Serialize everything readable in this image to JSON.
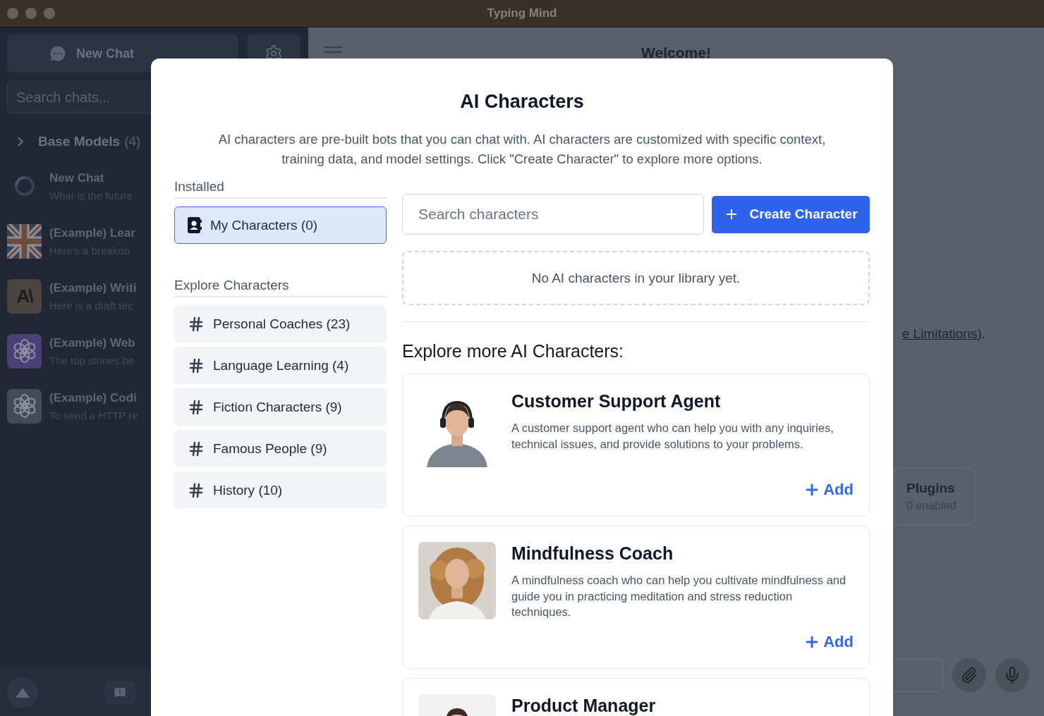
{
  "window": {
    "title": "Typing Mind"
  },
  "sidebar": {
    "new_chat": "New Chat",
    "search_placeholder": "Search chats...",
    "group": {
      "label": "Base Models",
      "count": "(4)",
      "expanded": false
    },
    "chats": [
      {
        "kind": "spinner",
        "title": "New Chat",
        "preview": "What is the future"
      },
      {
        "kind": "flag",
        "title": "(Example) Lear",
        "preview": "Here's a breakdo"
      },
      {
        "kind": "logo",
        "logo_text": "A\\",
        "color": "#4a4540",
        "title": "(Example) Writi",
        "preview": "Here is a draft tec"
      },
      {
        "kind": "knot",
        "color": "#4b3f78",
        "title": "(Example) Web",
        "preview": "The top stories be"
      },
      {
        "kind": "knot",
        "color": "#454b55",
        "title": "(Example) Codi",
        "preview": "To send a HTTP re"
      }
    ]
  },
  "main": {
    "title": "Welcome!",
    "link_text": "e Limitations",
    "link_tail": ").",
    "plugins": {
      "label": "Plugins",
      "status": "0 enabled"
    }
  },
  "modal": {
    "title": "AI Characters",
    "description": "AI characters are pre-built bots that you can chat with. AI characters are customized with specific context, training data, and model settings. Click \"Create Character\" to explore more options.",
    "installed_label": "Installed",
    "installed": [
      {
        "label": "My Characters (0)",
        "selected": true
      }
    ],
    "explore_label": "Explore Characters",
    "categories": [
      {
        "label": "Personal Coaches (23)",
        "selected": false
      },
      {
        "label": "Language Learning (4)",
        "selected": false
      },
      {
        "label": "Fiction Characters (9)",
        "selected": false
      },
      {
        "label": "Famous People (9)",
        "selected": false
      },
      {
        "label": "History (10)",
        "selected": false
      }
    ],
    "search_placeholder": "Search characters",
    "create_button": "Create Character",
    "empty_text": "No AI characters in your library yet.",
    "explore_heading": "Explore more AI Characters:",
    "characters": [
      {
        "name": "Customer Support Agent",
        "description": "A customer support agent who can help you with any inquiries, technical issues, and provide solutions to your problems.",
        "action": "Add"
      },
      {
        "name": "Mindfulness Coach",
        "description": "A mindfulness coach who can help you cultivate mindfulness and guide you in practicing meditation and stress reduction techniques.",
        "action": "Add"
      },
      {
        "name": "Product Manager"
      }
    ]
  }
}
